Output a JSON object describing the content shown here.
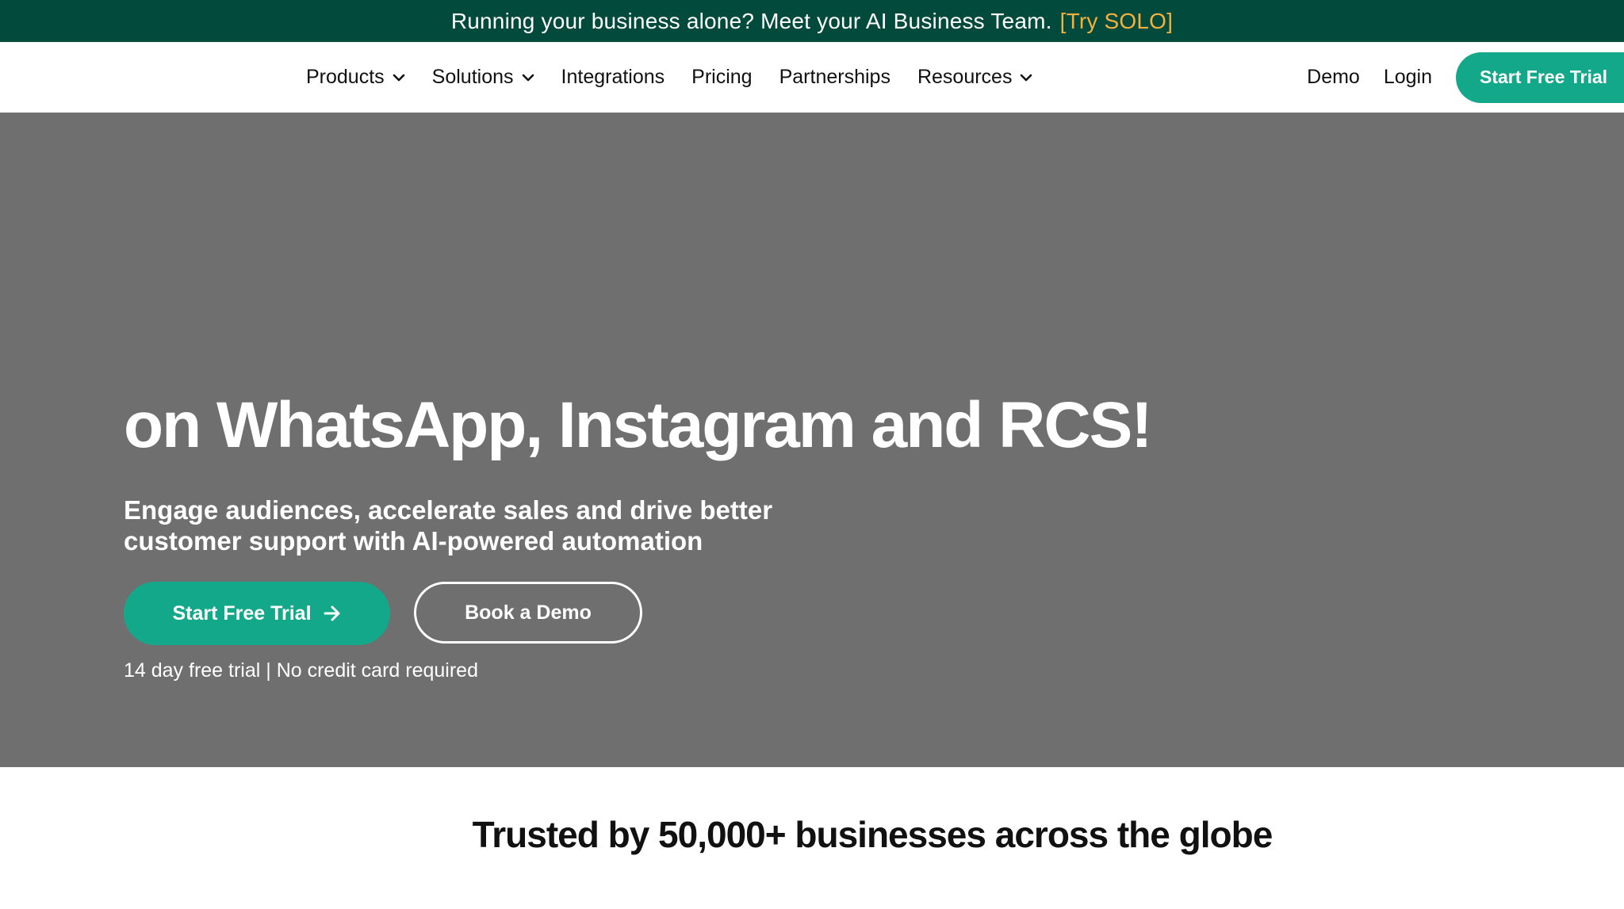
{
  "announcement": {
    "text": "Running your business alone? Meet your AI Business Team.",
    "promo_link": "[Try SOLO]",
    "bg_color": "#024a3c",
    "promo_color": "#f5b03d"
  },
  "nav": {
    "items": [
      {
        "label": "Products",
        "has_dropdown": true
      },
      {
        "label": "Solutions",
        "has_dropdown": true
      },
      {
        "label": "Integrations",
        "has_dropdown": false
      },
      {
        "label": "Pricing",
        "has_dropdown": false
      },
      {
        "label": "Partnerships",
        "has_dropdown": false
      },
      {
        "label": "Resources",
        "has_dropdown": true
      }
    ],
    "demo": "Demo",
    "login": "Login",
    "cta": "Start Free Trial"
  },
  "hero": {
    "headline": "on WhatsApp, Instagram and RCS!",
    "subheadline": "Engage audiences, accelerate sales and drive better customer support with AI-powered automation",
    "primary_button": "Start Free Trial",
    "secondary_button": "Book a Demo",
    "note": "14 day free trial | No credit card required",
    "bg_color": "#6f6f6f",
    "accent_color": "#14a88a"
  },
  "trusted": {
    "text": "Trusted by 50,000+ businesses across the globe"
  }
}
